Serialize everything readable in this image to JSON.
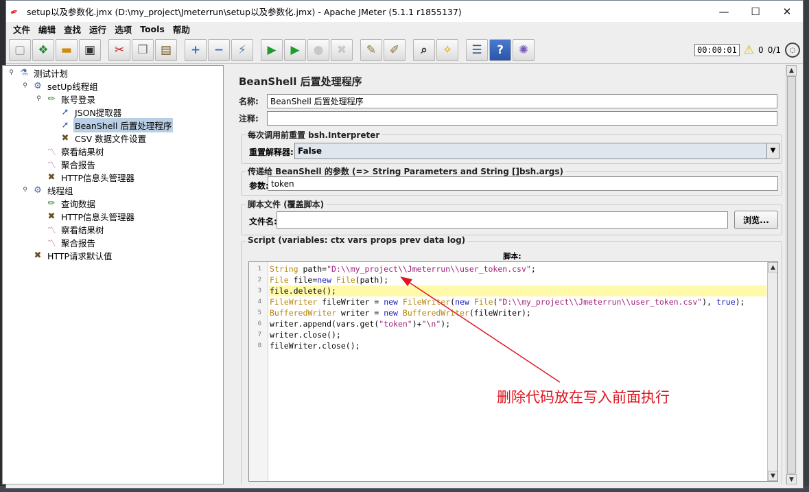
{
  "window": {
    "title": "setup以及参数化.jmx (D:\\my_project\\Jmeterrun\\setup以及参数化.jmx) - Apache JMeter (5.1.1 r1855137)",
    "controls": {
      "minimize": "—",
      "maximize": "☐",
      "close": "✕"
    }
  },
  "menu": [
    "文件",
    "编辑",
    "查找",
    "运行",
    "选项",
    "Tools",
    "帮助"
  ],
  "toolbar": {
    "buttons": [
      {
        "name": "new-icon",
        "glyph": "▢"
      },
      {
        "name": "templates-icon",
        "glyph": "❖"
      },
      {
        "name": "open-icon",
        "glyph": "▬"
      },
      {
        "name": "save-icon",
        "glyph": "▣"
      },
      {
        "name": "cut-icon",
        "glyph": "✂"
      },
      {
        "name": "copy-icon",
        "glyph": "❐"
      },
      {
        "name": "paste-icon",
        "glyph": "▤"
      },
      {
        "name": "expand-icon",
        "glyph": "+"
      },
      {
        "name": "collapse-icon",
        "glyph": "−"
      },
      {
        "name": "toggle-icon",
        "glyph": "⚡"
      },
      {
        "name": "start-icon",
        "glyph": "▶"
      },
      {
        "name": "start-no-pause-icon",
        "glyph": "▶"
      },
      {
        "name": "stop-icon",
        "glyph": "●"
      },
      {
        "name": "shutdown-icon",
        "glyph": "✖"
      },
      {
        "name": "clear-icon",
        "glyph": "✎"
      },
      {
        "name": "clear-all-icon",
        "glyph": "✐"
      },
      {
        "name": "search-icon",
        "glyph": "⌕"
      },
      {
        "name": "reset-search-icon",
        "glyph": "✧"
      },
      {
        "name": "function-helper-icon",
        "glyph": "☰"
      },
      {
        "name": "help-icon",
        "glyph": "?"
      },
      {
        "name": "remote-icon",
        "glyph": "✺"
      }
    ],
    "timer": "00:00:01",
    "warning_count": "0",
    "threads": "0/1"
  },
  "tree": {
    "nodes": [
      {
        "label": "测试计划",
        "icon": "flask-icon",
        "glyph": "⚗",
        "depth": 0
      },
      {
        "label": "setUp线程组",
        "icon": "gear-icon",
        "glyph": "⚙",
        "depth": 1
      },
      {
        "label": "账号登录",
        "icon": "sampler-icon",
        "glyph": "✏",
        "depth": 2
      },
      {
        "label": "JSON提取器",
        "icon": "extractor-icon",
        "glyph": "➚",
        "depth": 3
      },
      {
        "label": "BeanShell 后置处理程序",
        "icon": "postprocessor-icon",
        "glyph": "➚",
        "depth": 3,
        "selected": true
      },
      {
        "label": "CSV 数据文件设置",
        "icon": "config-icon",
        "glyph": "✖",
        "depth": 3
      },
      {
        "label": "察看结果树",
        "icon": "listener-icon",
        "glyph": "〽",
        "depth": 2
      },
      {
        "label": "聚合报告",
        "icon": "listener-icon",
        "glyph": "〽",
        "depth": 2
      },
      {
        "label": "HTTP信息头管理器",
        "icon": "config-icon",
        "glyph": "✖",
        "depth": 2
      },
      {
        "label": "线程组",
        "icon": "gear-icon",
        "glyph": "⚙",
        "depth": 1
      },
      {
        "label": "查询数据",
        "icon": "sampler-icon",
        "glyph": "✏",
        "depth": 2
      },
      {
        "label": "HTTP信息头管理器",
        "icon": "config-icon",
        "glyph": "✖",
        "depth": 2
      },
      {
        "label": "察看结果树",
        "icon": "listener-icon",
        "glyph": "〽",
        "depth": 2
      },
      {
        "label": "聚合报告",
        "icon": "listener-icon",
        "glyph": "〽",
        "depth": 2
      },
      {
        "label": "HTTP请求默认值",
        "icon": "config-icon",
        "glyph": "✖",
        "depth": 1
      }
    ]
  },
  "panel": {
    "title": "BeanShell 后置处理程序",
    "name_label": "名称:",
    "name_value": "BeanShell 后置处理程序",
    "comment_label": "注释:",
    "comment_value": "",
    "reset_group": "每次调用前重置 bsh.Interpreter",
    "reset_label": "重置解释器:",
    "reset_value": "False",
    "params_group": "传递给 BeanShell 的参数 (=> String Parameters and String []bsh.args)",
    "params_label": "参数:",
    "params_value": "token",
    "file_group": "脚本文件 (覆盖脚本)",
    "file_label": "文件名:",
    "file_value": "",
    "browse_label": "浏览...",
    "script_group": "Script (variables: ctx vars props prev data log)",
    "script_label": "脚本:"
  },
  "code": [
    {
      "num": "1",
      "html": "<span style=\"color:#b8860b\">String</span> path=<span style=\"color:#a0207a\">\"D:\\\\my_project\\\\Jmeterrun\\\\user_token.csv\"</span>;"
    },
    {
      "num": "2",
      "html": "<span style=\"color:#b8860b\">File</span> file=<span style=\"color:#1818c0\">new</span> <span style=\"color:#b8860b\">File</span>(path);"
    },
    {
      "num": "3",
      "html": "file.delete();",
      "current": true
    },
    {
      "num": "4",
      "html": "<span style=\"color:#b8860b\">FileWriter</span> fileWriter = <span style=\"color:#1818c0\">new</span> <span style=\"color:#b8860b\">FileWriter</span>(<span style=\"color:#1818c0\">new</span> <span style=\"color:#b8860b\">File</span>(<span style=\"color:#a0207a\">\"D:\\\\my_project\\\\Jmeterrun\\\\user_token.csv\"</span>), <span style=\"color:#1818c0\">true</span>);"
    },
    {
      "num": "5",
      "html": "<span style=\"color:#b8860b\">BufferedWriter</span> writer = <span style=\"color:#1818c0\">new</span> <span style=\"color:#b8860b\">BufferedWriter</span>(fileWriter);"
    },
    {
      "num": "6",
      "html": "writer.append(vars.get(<span style=\"color:#a0207a\">\"token\"</span>)+<span style=\"color:#a0207a\">\"\\n\"</span>);"
    },
    {
      "num": "7",
      "html": "writer.close();"
    },
    {
      "num": "8",
      "html": "fileWriter.close();"
    }
  ],
  "annotation": "删除代码放在写入前面执行",
  "colors": {
    "selection": "#b8cfe5",
    "current_line": "#fffaaa",
    "annotation": "#e0151f"
  }
}
